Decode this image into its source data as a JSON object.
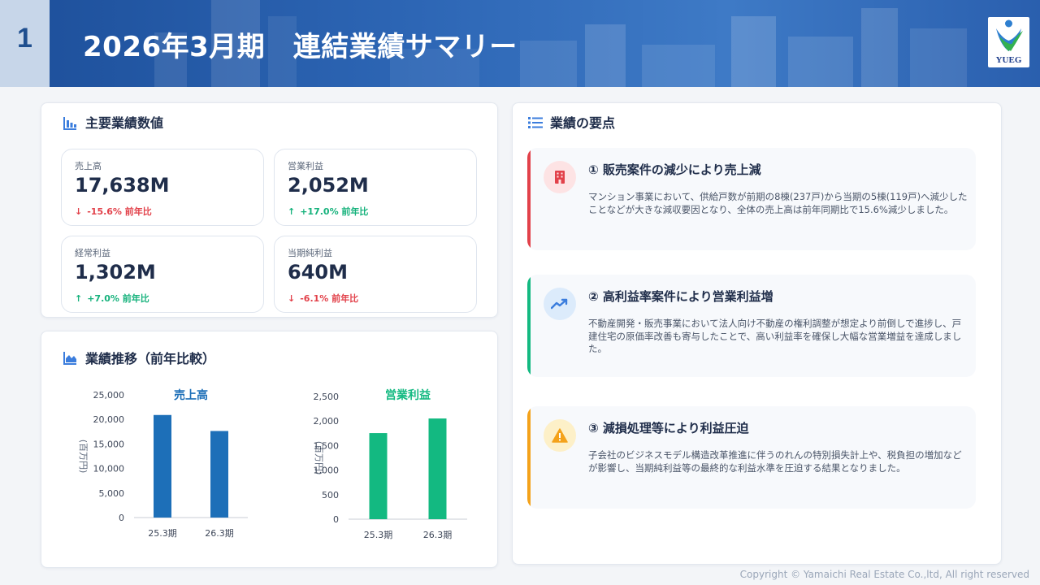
{
  "header": {
    "page_number": "1",
    "title": "2026年3月期　連結業績サマリー",
    "logo_text": "YUEG"
  },
  "kpi_section": {
    "title": "主要業績数値",
    "items": [
      {
        "label": "売上高",
        "value": "17,638M",
        "change": "-15.6% 前年比",
        "direction": "down"
      },
      {
        "label": "営業利益",
        "value": "2,052M",
        "change": "+17.0% 前年比",
        "direction": "up"
      },
      {
        "label": "経常利益",
        "value": "1,302M",
        "change": "+7.0% 前年比",
        "direction": "up"
      },
      {
        "label": "当期純利益",
        "value": "640M",
        "change": "-6.1% 前年比",
        "direction": "down"
      }
    ]
  },
  "trend_section": {
    "title": "業績推移（前年比較）"
  },
  "chart_data": [
    {
      "type": "bar",
      "title": "売上高",
      "ylabel": "(百万円)",
      "categories": [
        "25.3期",
        "26.3期"
      ],
      "values": [
        20900,
        17638
      ],
      "ylim": [
        0,
        25000
      ],
      "yticks": [
        "25,000",
        "20,000",
        "15,000",
        "10,000",
        "5,000",
        "0"
      ],
      "color": "#1d6fb8"
    },
    {
      "type": "bar",
      "title": "営業利益",
      "ylabel": "(百万円)",
      "categories": [
        "25.3期",
        "26.3期"
      ],
      "values": [
        1754,
        2052
      ],
      "ylim": [
        0,
        2500
      ],
      "yticks": [
        "2,500",
        "2,000",
        "1,500",
        "1,000",
        "500",
        "0"
      ],
      "color": "#13b981"
    }
  ],
  "points_section": {
    "title": "業績の要点",
    "items": [
      {
        "title": "① 販売案件の減少により売上減",
        "body": "マンション事業において、供給戸数が前期の8棟(237戸)から当期の5棟(119戸)へ減少したことなどが大きな減収要因となり、全体の売上高は前年同期比で15.6%減少しました。",
        "accent": "#e2414a",
        "icon": "building-icon"
      },
      {
        "title": "② 高利益率案件により営業利益増",
        "body": "不動産開発・販売事業において法人向け不動産の権利調整が想定より前倒しで進捗し、戸建住宅の原価率改善も寄与したことで、高い利益率を確保し大幅な営業増益を達成しました。",
        "accent": "#13b981",
        "icon": "trend-up-icon"
      },
      {
        "title": "③ 減損処理等により利益圧迫",
        "body": "子会社のビジネスモデル構造改革推進に伴うのれんの特別損失計上や、税負担の増加などが影響し、当期純利益等の最終的な利益水準を圧迫する結果となりました。",
        "accent": "#f4a21a",
        "icon": "warning-icon"
      }
    ]
  },
  "footer": {
    "copyright": "Copyright © Yamaichi Real Estate Co.,ltd, All right reserved"
  }
}
